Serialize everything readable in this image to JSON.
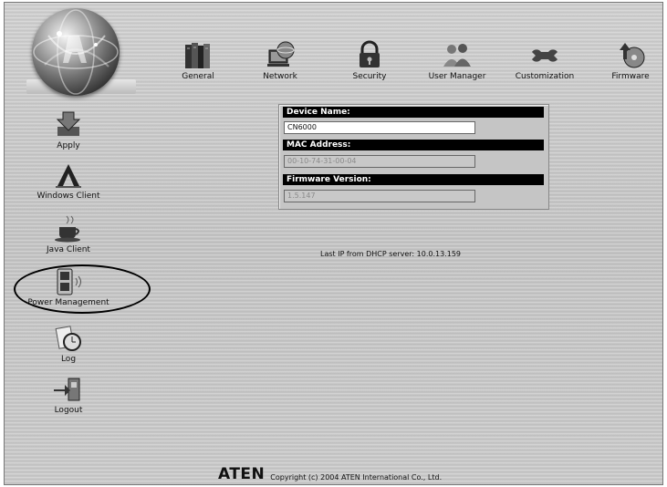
{
  "toolbar": {
    "items": [
      {
        "label": "General",
        "icon": "books-icon"
      },
      {
        "label": "Network",
        "icon": "network-globe-icon"
      },
      {
        "label": "Security",
        "icon": "padlock-icon"
      },
      {
        "label": "User Manager",
        "icon": "users-icon"
      },
      {
        "label": "Customization",
        "icon": "wrench-icon"
      },
      {
        "label": "Firmware",
        "icon": "firmware-disc-icon"
      }
    ]
  },
  "sidebar": {
    "items": [
      {
        "label": "Apply",
        "icon": "apply-download-icon"
      },
      {
        "label": "Windows Client",
        "icon": "windows-client-icon"
      },
      {
        "label": "Java Client",
        "icon": "java-cup-icon"
      },
      {
        "label": "Power Management",
        "icon": "power-outlet-icon",
        "highlighted": true
      },
      {
        "label": "Log",
        "icon": "log-clock-icon"
      },
      {
        "label": "Logout",
        "icon": "logout-door-icon"
      }
    ]
  },
  "device": {
    "name_label": "Device Name:",
    "name_value": "CN6000",
    "mac_label": "MAC Address:",
    "mac_value": "00-10-74-31-00-04",
    "firmware_label": "Firmware Version:",
    "firmware_value": "1.5.147"
  },
  "status": {
    "dhcp_text": "Last IP from DHCP server: 10.0.13.159"
  },
  "footer": {
    "brand": "ATEN",
    "copyright": "Copyright (c) 2004 ATEN International Co., Ltd."
  },
  "colors": {
    "background": "#c8c8c8",
    "header_bar": "#000000",
    "highlight_ellipse": "#000000"
  }
}
